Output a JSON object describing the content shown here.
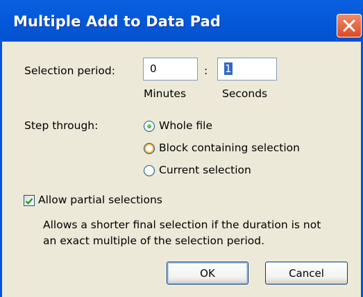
{
  "window": {
    "title": "Multiple Add to Data Pad"
  },
  "selection_period": {
    "label": "Selection period:",
    "minutes_value": "0",
    "separator": ":",
    "seconds_value": "1",
    "minutes_caption": "Minutes",
    "seconds_caption": "Seconds"
  },
  "step_through": {
    "label": "Step through:",
    "options": [
      {
        "label": "Whole file",
        "selected": true
      },
      {
        "label": "Block containing selection",
        "selected": false
      },
      {
        "label": "Current selection",
        "selected": false
      }
    ]
  },
  "partial": {
    "checkbox_label": "Allow partial selections",
    "checked": true,
    "description_line1": "Allows a shorter final selection if the duration is not",
    "description_line2": "an exact multiple of the selection period."
  },
  "buttons": {
    "ok": "OK",
    "cancel": "Cancel"
  },
  "colors": {
    "titlebar": "#0458d8",
    "close": "#db4a25",
    "dialog_bg": "#ece9d8",
    "radio_dot": "#21a121"
  }
}
